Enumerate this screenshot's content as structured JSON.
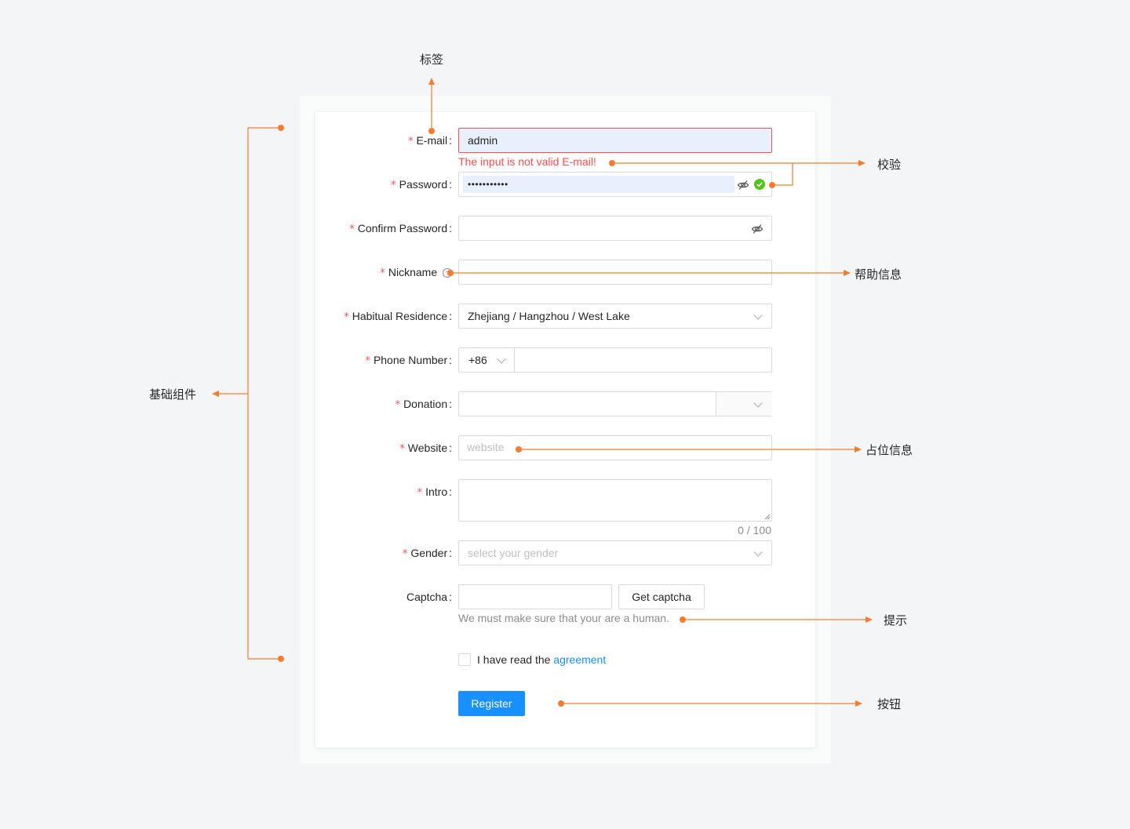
{
  "form": {
    "email": {
      "label": "E-mail",
      "value": "admin",
      "error": "The input is not valid E-mail!"
    },
    "password": {
      "label": "Password",
      "value": "•••••••••••"
    },
    "confirm": {
      "label": "Confirm Password",
      "value": ""
    },
    "nickname": {
      "label": "Nickname",
      "help_icon": "question-circle-icon"
    },
    "residence": {
      "label": "Habitual Residence",
      "value": "Zhejiang / Hangzhou / West Lake"
    },
    "phone": {
      "label": "Phone Number",
      "prefix": "+86",
      "value": ""
    },
    "donation": {
      "label": "Donation",
      "value": ""
    },
    "website": {
      "label": "Website",
      "placeholder": "website"
    },
    "intro": {
      "label": "Intro",
      "counter": "0 / 100"
    },
    "gender": {
      "label": "Gender",
      "placeholder": "select your gender"
    },
    "captcha": {
      "label": "Captcha",
      "button": "Get captcha",
      "extra": "We must make sure that your are a human."
    },
    "agreement": {
      "text": "I have read the",
      "link": "agreement"
    },
    "register": "Register",
    "required_mark": "*",
    "colon": ":"
  },
  "annotations": {
    "label": "标签",
    "validation": "校验",
    "help": "帮助信息",
    "basic": "基础组件",
    "placeholder": "占位信息",
    "hint": "提示",
    "button": "按钮"
  },
  "colors": {
    "accent": "#f47c30",
    "primary": "#1890ff",
    "error": "#ff4d4f",
    "success": "#52c41a"
  }
}
